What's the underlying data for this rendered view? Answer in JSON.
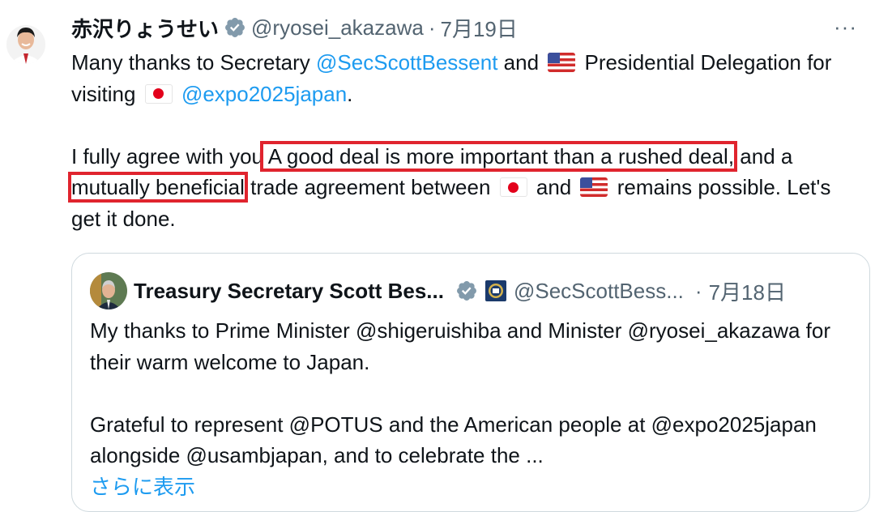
{
  "tweet": {
    "author_name": "赤沢りょうせい",
    "handle": "@ryosei_akazawa",
    "separator": "·",
    "date": "7月19日",
    "more_label": "···",
    "p1": {
      "t1": "Many thanks to Secretary ",
      "mention1": "@SecScottBessent",
      "t2": " and ",
      "t3": " Presidential Delegation for visiting ",
      "mention2": "@expo2025japan",
      "t4": "."
    },
    "p2": {
      "t1": "I fully agree with you",
      "hl1": " A good deal is more important than a rushed deal,",
      "t2": " and a ",
      "hl2": "mutually beneficial",
      "t3": " trade agreement between ",
      "t4": " and ",
      "t5": " remains possible. Let's get it done."
    }
  },
  "quote": {
    "author_name": "Treasury Secretary Scott Bes...",
    "handle": "@SecScottBess...",
    "separator": "·",
    "date": "7月18日",
    "p1": "My thanks to Prime Minister @shigeruishiba and Minister @ryosei_akazawa for their warm welcome to Japan.",
    "p2": "Grateful to represent @POTUS and the American people at @expo2025japan alongside @usambjapan, and to celebrate the ...",
    "show_more": "さらに表示"
  },
  "colors": {
    "link": "#1d9bf0",
    "secondary_text": "#536471",
    "highlight_box": "#e0242e",
    "verified_badge": "#829aab"
  },
  "icons": [
    "verified-badge-icon",
    "more-options-icon",
    "us-flag-icon",
    "japan-flag-icon",
    "treasury-seal-icon"
  ]
}
